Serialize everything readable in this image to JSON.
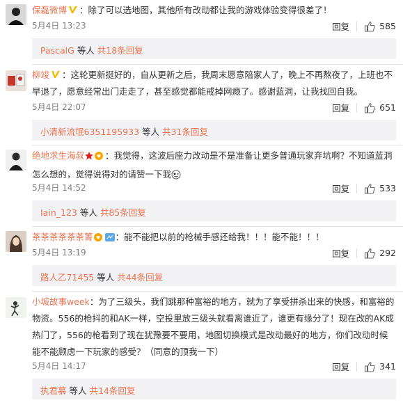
{
  "comments": [
    {
      "user": "保磊微博",
      "colon": "：",
      "text": "除了可以选地图，其他所有改动都让我的游戏体验变得很差了！",
      "time": "5月4日 13:23",
      "reply": "回复",
      "likes": "585",
      "sub_user": "PascalG",
      "sub_text": " 等人 ",
      "sub_count": "共18条回复"
    },
    {
      "user": "柳竣",
      "colon": "：",
      "text": "这轮更新挺好的，自从更新之后，我周末愿意陪家人了，晚上不再熬夜了，上班也不早退了，愿意经常出门走走了，甚至感觉都能戒掉网瘾了。感谢蓝洞，让我找回自我。",
      "time": "5月4日 22:07",
      "reply": "回复",
      "likes": "651",
      "sub_user": "小清新流氓6351195933",
      "sub_text": " 等人 ",
      "sub_count": "共31条回复"
    },
    {
      "user": "绝地求生海叔",
      "colon": "：",
      "text": "我觉得，这波后座力改动是不是准备让更多普通玩家弃坑啊？不知道蓝洞怎么想的，觉得说得对的请赞一下我",
      "time": "5月4日 14:52",
      "reply": "回复",
      "likes": "533",
      "sub_user": "Iain_123",
      "sub_text": " 等人 ",
      "sub_count": "共85条回复"
    },
    {
      "user": "茶茶茶茶茶茶箐",
      "colon": "：",
      "text": "能不能把以前的枪械手感还给我！！！能不能！！！",
      "time": "5月4日 13:19",
      "reply": "回复",
      "likes": "292",
      "sub_user": "路人乙71455",
      "sub_text": " 等人 ",
      "sub_count": "共44条回复"
    },
    {
      "user": "小城故事week",
      "colon": "：",
      "text": "为了三级头，我们跳那种富裕的地方，就为了享受拼杀出来的快感，和富裕的物资。556的枪抖的和AK一样，空投里放三级头就看离谁近了，谁更有缘分了！现在改的AK成热门了，556的枪看到了现在犹豫要不要用，地图切换模式是改动最好的地方，你们改动时候能不能顾虑一下玩家的感受？（同意的顶我一下）",
      "time": "5月4日 14:17",
      "reply": "回复",
      "likes": "341",
      "sub_user": "执君慕",
      "sub_text": " 等人 ",
      "sub_count": "共14条回复"
    }
  ],
  "colors": {
    "user": "#eb7350",
    "text": "#333333",
    "time": "#808080",
    "replybox": "#f2f2f5"
  }
}
